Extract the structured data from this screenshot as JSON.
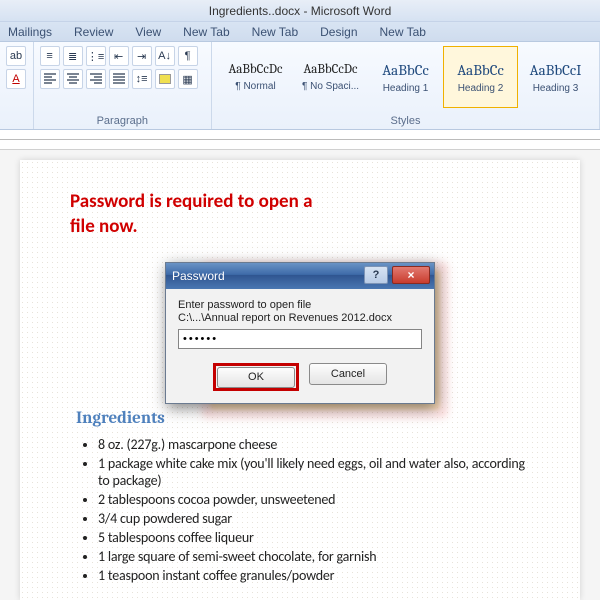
{
  "window": {
    "title": "Ingredients..docx - Microsoft Word"
  },
  "tabs": [
    "Mailings",
    "Review",
    "View",
    "New Tab",
    "New Tab",
    "Design",
    "New Tab"
  ],
  "ribbon": {
    "paragraph_label": "Paragraph",
    "styles_label": "Styles",
    "styles": [
      {
        "preview": "AaBbCcDc",
        "name": "¶ Normal"
      },
      {
        "preview": "AaBbCcDc",
        "name": "¶ No Spaci..."
      },
      {
        "preview": "AaBbCc",
        "name": "Heading 1"
      },
      {
        "preview": "AaBbCc",
        "name": "Heading 2"
      },
      {
        "preview": "AaBbCcI",
        "name": "Heading 3"
      }
    ],
    "selected_style_index": 3
  },
  "annotation": {
    "line1": "Password is required to open a",
    "line2": "file now."
  },
  "document": {
    "heading": "Ingredients",
    "items": [
      "8 oz. (227g.) mascarpone cheese",
      "1 package white cake mix (you'll likely need eggs, oil and water also, according to package)",
      "2 tablespoons cocoa powder, unsweetened",
      "3/4 cup powdered sugar",
      "5 tablespoons coffee liqueur",
      "1 large square of semi-sweet chocolate, for garnish",
      "1 teaspoon instant coffee granules/powder"
    ]
  },
  "dialog": {
    "title": "Password",
    "prompt1": "Enter password to open file",
    "prompt2": "C:\\...\\Annual report on Revenues 2012.docx",
    "value": "••••••",
    "ok": "OK",
    "cancel": "Cancel",
    "help": "?",
    "close": "×"
  }
}
